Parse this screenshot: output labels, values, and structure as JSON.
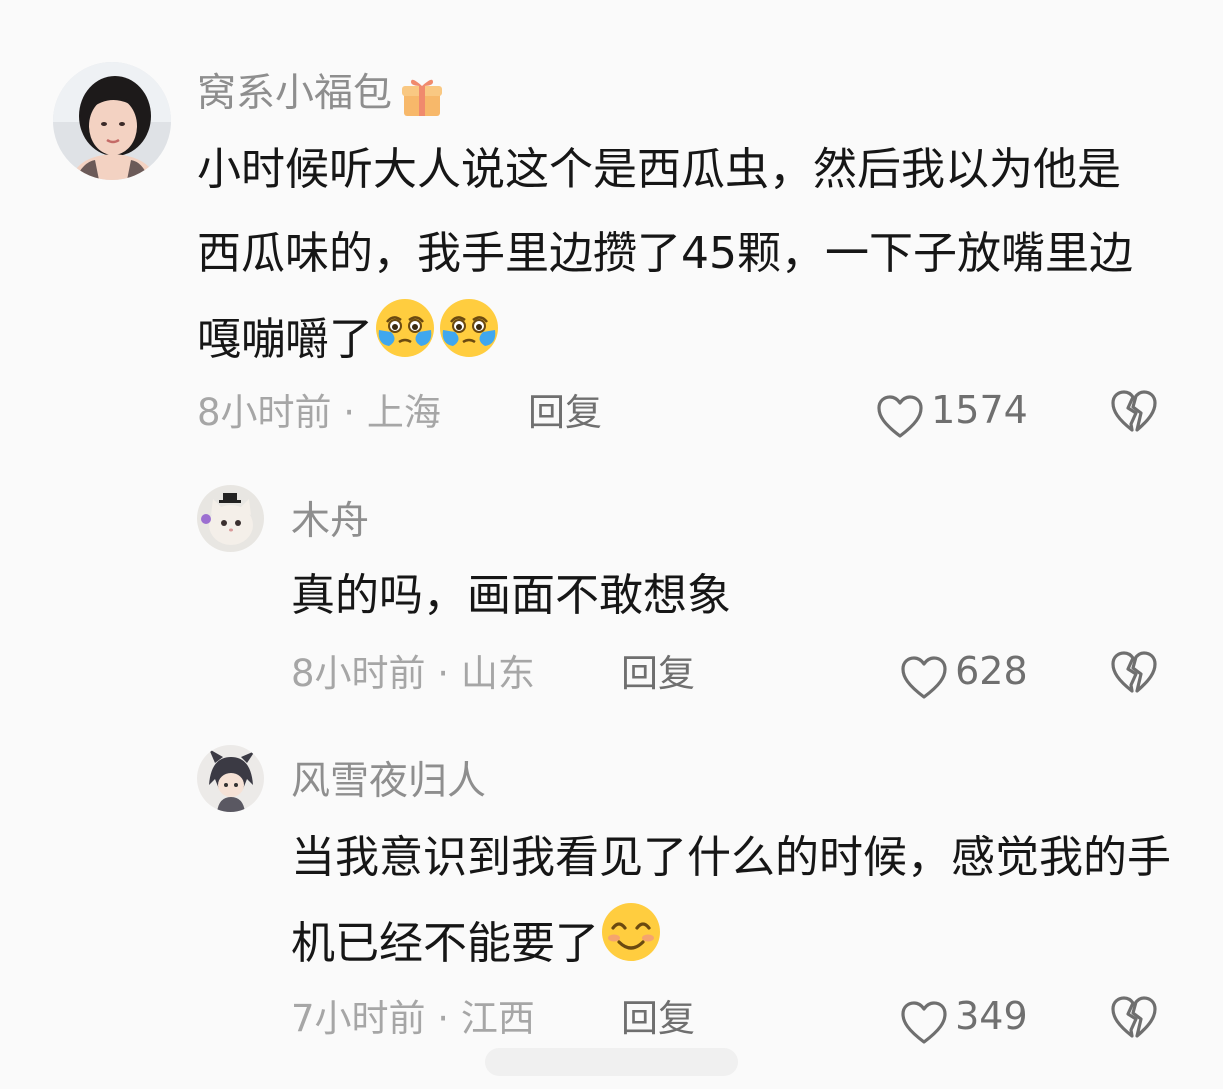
{
  "comments": [
    {
      "username": "窝系小福包",
      "username_emoji": "gift",
      "text": "小时候听大人说这个是西瓜虫，然后我以为他是西瓜味的，我手里边攒了45颗，一下子放嘴里边嘎嘣嚼了",
      "text_emojis": [
        "crying-face",
        "crying-face"
      ],
      "time": "8小时前",
      "location": "上海",
      "reply_label": "回复",
      "likes": "1574"
    },
    {
      "username": "木舟",
      "text": "真的吗，画面不敢想象",
      "time": "8小时前",
      "location": "山东",
      "reply_label": "回复",
      "likes": "628"
    },
    {
      "username": "风雪夜归人",
      "text": "当我意识到我看见了什么的时候，感觉我的手机已经不能要了",
      "text_emojis": [
        "smiling-face"
      ],
      "time": "7小时前",
      "location": "江西",
      "reply_label": "回复",
      "likes": "349"
    }
  ],
  "colors": {
    "background": "#fafafa",
    "text": "#161616",
    "secondary": "#8e8e8e",
    "muted": "#a6a6a6"
  },
  "separator": " · "
}
